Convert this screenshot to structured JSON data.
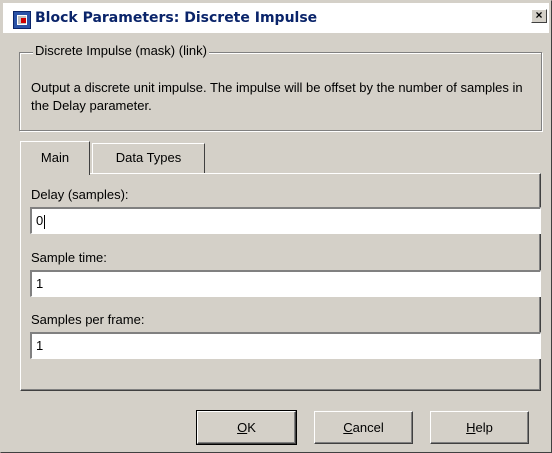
{
  "window": {
    "title": "Block Parameters: Discrete  Impulse",
    "close_glyph": "×"
  },
  "group": {
    "legend": "Discrete Impulse  (mask) (link)",
    "description": "Output a discrete unit impulse.  The impulse will be offset by the number of samples in the Delay parameter."
  },
  "tabs": [
    {
      "label": "Main",
      "active": true
    },
    {
      "label": "Data Types",
      "active": false
    }
  ],
  "fields": {
    "delay": {
      "label": "Delay (samples):",
      "value": "0"
    },
    "sample_time": {
      "label": "Sample time:",
      "value": "1"
    },
    "samples_per_frame": {
      "label": "Samples per frame:",
      "value": "1"
    }
  },
  "buttons": {
    "ok": {
      "mnemonic": "O",
      "rest": "K"
    },
    "cancel": {
      "mnemonic": "C",
      "rest": "ancel"
    },
    "help": {
      "mnemonic": "H",
      "rest": "elp"
    }
  },
  "icons": {
    "app": "simulink-block-icon",
    "close": "close-icon"
  }
}
